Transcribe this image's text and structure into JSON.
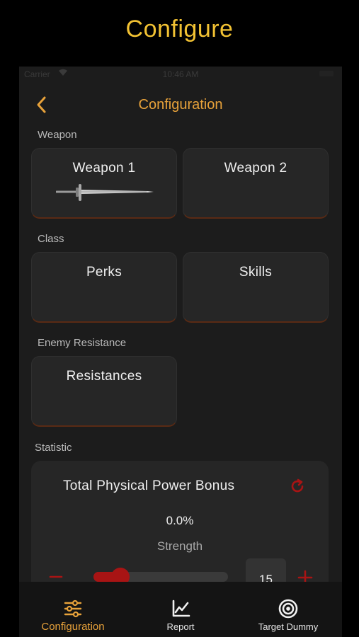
{
  "promo": {
    "title": "Configure"
  },
  "statusbar": {
    "carrier": "Carrier",
    "time": "10:46 AM"
  },
  "nav": {
    "title": "Configuration",
    "back_icon": "chevron-left-icon"
  },
  "sections": {
    "weapon": "Weapon",
    "class": "Class",
    "enemy": "Enemy Resistance",
    "statistic": "Statistic"
  },
  "cards": {
    "weapon1": "Weapon 1",
    "weapon2": "Weapon 2",
    "perks": "Perks",
    "skills": "Skills",
    "resistances": "Resistances"
  },
  "statistic": {
    "title": "Total Physical Power Bonus",
    "value": "0.0%",
    "attribute": "Strength",
    "stepper_value": "15",
    "slider_fraction": 0.2,
    "reset_icon": "refresh-icon"
  },
  "tabs": [
    {
      "label": "Configuration",
      "icon": "sliders-icon",
      "active": true
    },
    {
      "label": "Report",
      "icon": "line-chart-icon",
      "active": false
    },
    {
      "label": "Target Dummy",
      "icon": "target-icon",
      "active": false
    }
  ],
  "colors": {
    "accent": "#e8a23a",
    "promo_title": "#f2c233",
    "danger": "#a81414",
    "background": "#1c1c1c",
    "card": "#262626"
  }
}
